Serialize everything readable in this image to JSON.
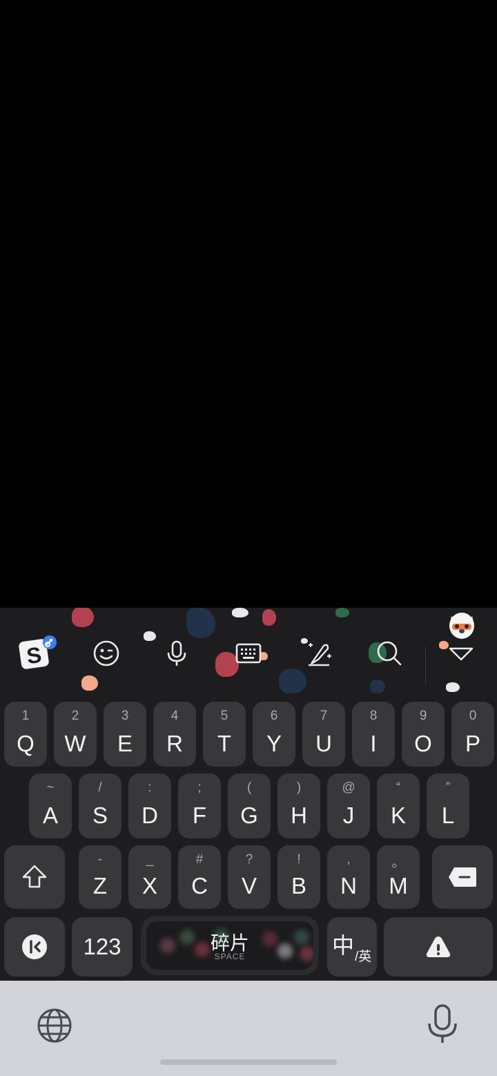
{
  "toolbar": {
    "items": [
      {
        "name": "sogou-logo-icon"
      },
      {
        "name": "emoji-icon"
      },
      {
        "name": "voice-input-icon"
      },
      {
        "name": "keyboard-layout-icon"
      },
      {
        "name": "handwriting-icon"
      },
      {
        "name": "search-icon"
      },
      {
        "name": "collapse-keyboard-icon"
      }
    ]
  },
  "keys": {
    "row1": [
      {
        "main": "Q",
        "sub": "1"
      },
      {
        "main": "W",
        "sub": "2"
      },
      {
        "main": "E",
        "sub": "3"
      },
      {
        "main": "R",
        "sub": "4"
      },
      {
        "main": "T",
        "sub": "5"
      },
      {
        "main": "Y",
        "sub": "6"
      },
      {
        "main": "U",
        "sub": "7"
      },
      {
        "main": "I",
        "sub": "8"
      },
      {
        "main": "O",
        "sub": "9"
      },
      {
        "main": "P",
        "sub": "0"
      }
    ],
    "row2": [
      {
        "main": "A",
        "sub": "~"
      },
      {
        "main": "S",
        "sub": "/"
      },
      {
        "main": "D",
        "sub": ":"
      },
      {
        "main": "F",
        "sub": ";"
      },
      {
        "main": "G",
        "sub": "("
      },
      {
        "main": "H",
        "sub": ")"
      },
      {
        "main": "J",
        "sub": "@"
      },
      {
        "main": "K",
        "sub": "“"
      },
      {
        "main": "L",
        "sub": "”"
      }
    ],
    "row3": [
      {
        "main": "Z",
        "sub": "-"
      },
      {
        "main": "X",
        "sub": "_"
      },
      {
        "main": "C",
        "sub": "#"
      },
      {
        "main": "V",
        "sub": "?"
      },
      {
        "main": "B",
        "sub": "!"
      },
      {
        "main": "N",
        "sub": ","
      },
      {
        "main": "M",
        "sub": "。"
      }
    ],
    "numeric_label": "123",
    "space_label": "碎片",
    "space_sub": "SPACE",
    "lang_main": "中",
    "lang_sub": "/英"
  },
  "colors": {
    "keyboard_bg": "#1d1d1f",
    "key_bg": "#38383b",
    "navbar_bg": "#d3d4d9",
    "confetti": [
      "#b4414f",
      "#2a3a52",
      "#e8e8ea",
      "#2f6b4a",
      "#f2a98a",
      "#e0e0e0"
    ]
  }
}
